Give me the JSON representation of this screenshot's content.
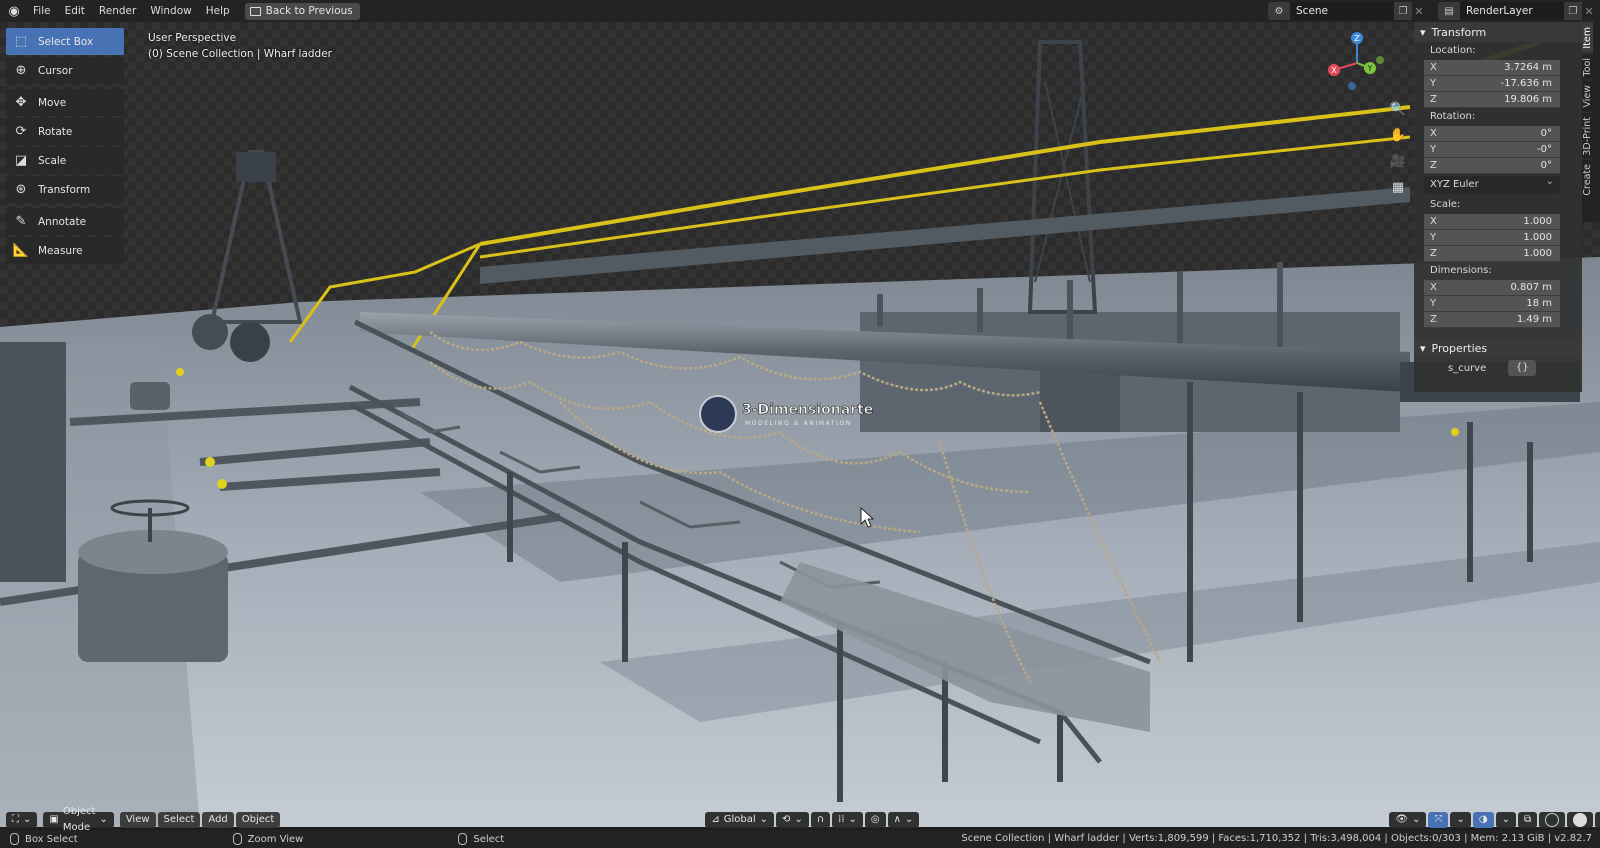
{
  "topbar": {
    "menus": [
      "File",
      "Edit",
      "Render",
      "Window",
      "Help"
    ],
    "back_label": "Back to Previous",
    "scene_value": "Scene",
    "render_layer_value": "RenderLayer"
  },
  "toolbar": {
    "tools": [
      {
        "label": "Select Box",
        "icon": "select-box-icon"
      },
      {
        "label": "Cursor",
        "icon": "cursor-icon"
      },
      {
        "label": "Move",
        "icon": "move-icon"
      },
      {
        "label": "Rotate",
        "icon": "rotate-icon"
      },
      {
        "label": "Scale",
        "icon": "scale-icon"
      },
      {
        "label": "Transform",
        "icon": "transform-icon"
      },
      {
        "label": "Annotate",
        "icon": "annotate-icon"
      },
      {
        "label": "Measure",
        "icon": "measure-icon"
      }
    ]
  },
  "viewport": {
    "perspective": "User Perspective",
    "collection": "(0) Scene Collection | Wharf ladder",
    "watermark_title": "3-Dimensionarte",
    "watermark_sub": "MODELING & ANIMATION"
  },
  "gizmo": {
    "x": "X",
    "y": "Y",
    "z": "Z"
  },
  "npanel": {
    "transform_title": "Transform",
    "location_label": "Location:",
    "location": [
      {
        "axis": "X",
        "value": "3.7264 m"
      },
      {
        "axis": "Y",
        "value": "-17.636 m"
      },
      {
        "axis": "Z",
        "value": "19.806 m"
      }
    ],
    "rotation_label": "Rotation:",
    "rotation": [
      {
        "axis": "X",
        "value": "0°"
      },
      {
        "axis": "Y",
        "value": "-0°"
      },
      {
        "axis": "Z",
        "value": "0°"
      }
    ],
    "rotation_mode": "XYZ Euler",
    "scale_label": "Scale:",
    "scale": [
      {
        "axis": "X",
        "value": "1.000"
      },
      {
        "axis": "Y",
        "value": "1.000"
      },
      {
        "axis": "Z",
        "value": "1.000"
      }
    ],
    "dimensions_label": "Dimensions:",
    "dimensions": [
      {
        "axis": "X",
        "value": "0.807 m"
      },
      {
        "axis": "Y",
        "value": "18 m"
      },
      {
        "axis": "Z",
        "value": "1.49 m"
      }
    ],
    "properties_title": "Properties",
    "prop_name": "s_curve",
    "prop_value": "{}"
  },
  "vtabs": [
    "Item",
    "Tool",
    "View",
    "3D-Print",
    "Create"
  ],
  "header": {
    "mode": "Object Mode",
    "menus": [
      "View",
      "Select",
      "Add",
      "Object"
    ],
    "orientation": "Global"
  },
  "statusbar": {
    "left1": "Box Select",
    "left2": "Zoom View",
    "left3": "Select",
    "right": "Scene Collection | Wharf ladder | Verts:1,809,599 | Faces:1,710,352 | Tris:3,498,004 | Objects:0/303 | Mem: 2.13 GiB | v2.82.7"
  },
  "colors": {
    "accent": "#4772b3",
    "rail_yellow": "#d8c21a",
    "axis_x": "#e04a5a",
    "axis_y": "#7ac73d",
    "axis_z": "#3d8bd9"
  }
}
